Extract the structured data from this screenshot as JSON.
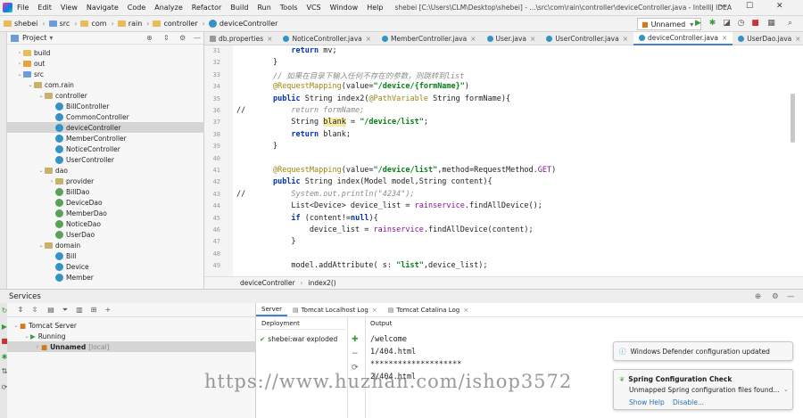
{
  "menubar": {
    "items": [
      "File",
      "Edit",
      "View",
      "Navigate",
      "Code",
      "Analyze",
      "Refactor",
      "Build",
      "Run",
      "Tools",
      "VCS",
      "Window",
      "Help"
    ],
    "window_title": "shebei [C:\\Users\\CLM\\Desktop\\shebei] - ...\\src\\com\\rain\\controller\\deviceController.java - IntelliJ IDEA"
  },
  "breadcrumbs": [
    "shebei",
    "src",
    "com",
    "rain",
    "controller",
    "deviceController"
  ],
  "run_config": "Unnamed",
  "project": {
    "title": "Project",
    "tree": [
      {
        "label": "build",
        "type": "folder",
        "arrow": "›"
      },
      {
        "label": "out",
        "type": "folder-orange",
        "arrow": "›"
      },
      {
        "label": "src",
        "type": "folder-blue",
        "arrow": "⌄"
      },
      {
        "label": "com.rain",
        "type": "package",
        "arrow": "⌄"
      },
      {
        "label": "controller",
        "type": "package",
        "arrow": "⌄"
      },
      {
        "label": "BillController",
        "type": "class",
        "arrow": ""
      },
      {
        "label": "CommonController",
        "type": "class",
        "arrow": ""
      },
      {
        "label": "deviceController",
        "type": "class",
        "arrow": "",
        "selected": true
      },
      {
        "label": "MemberController",
        "type": "class",
        "arrow": ""
      },
      {
        "label": "NoticeController",
        "type": "class",
        "arrow": ""
      },
      {
        "label": "UserController",
        "type": "class",
        "arrow": ""
      },
      {
        "label": "dao",
        "type": "package",
        "arrow": "⌄"
      },
      {
        "label": "provider",
        "type": "package",
        "arrow": "›"
      },
      {
        "label": "BillDao",
        "type": "interface",
        "arrow": ""
      },
      {
        "label": "DeviceDao",
        "type": "interface",
        "arrow": ""
      },
      {
        "label": "MemberDao",
        "type": "interface",
        "arrow": ""
      },
      {
        "label": "NoticeDao",
        "type": "interface",
        "arrow": ""
      },
      {
        "label": "UserDao",
        "type": "interface",
        "arrow": ""
      },
      {
        "label": "domain",
        "type": "package",
        "arrow": "⌄"
      },
      {
        "label": "Bill",
        "type": "class",
        "arrow": ""
      },
      {
        "label": "Device",
        "type": "class",
        "arrow": ""
      },
      {
        "label": "Member",
        "type": "class",
        "arrow": ""
      }
    ]
  },
  "tabs": [
    "db.properties",
    "NoticeController.java",
    "MemberController.java",
    "User.java",
    "UserController.java",
    "deviceController.java",
    "UserDao.java"
  ],
  "active_tab": "deviceController.java",
  "code_lines": [
    {
      "n": "31",
      "html": "            <span class=\"kw\">return</span> mv;"
    },
    {
      "n": "32",
      "html": "        }"
    },
    {
      "n": "33",
      "html": "        <span class=\"cmt\">// 如果在目录下输入任何不存在的参数，则跳转到list</span>"
    },
    {
      "n": "34",
      "html": "        <span class=\"ann\">@RequestMapping</span>(value=<span class=\"str\">\"/device/{formName}\"</span>)"
    },
    {
      "n": "35",
      "html": "        <span class=\"kw\">public</span> String index2(<span class=\"ann\">@PathVariable</span> String formName){"
    },
    {
      "n": "36",
      "html": "//          <span class=\"cmt\">return formName;</span>"
    },
    {
      "n": "37",
      "html": "            String <span class=\"hl\">blank</span> = <span class=\"str\">\"/device/list\"</span>;"
    },
    {
      "n": "38",
      "html": "            <span class=\"kw\">return</span> blank;"
    },
    {
      "n": "39",
      "html": "        }"
    },
    {
      "n": "40",
      "html": ""
    },
    {
      "n": "41",
      "html": "        <span class=\"ann\">@RequestMapping</span>(value=<span class=\"str\">\"/device/list\"</span>,method=RequestMethod.<span class=\"fld\">GET</span>)"
    },
    {
      "n": "42",
      "html": "        <span class=\"kw\">public</span> String index(Model model,String content){"
    },
    {
      "n": "43",
      "html": "//          <span class=\"cmt\">System.out.println(\"4234\");</span>"
    },
    {
      "n": "44",
      "html": "            List&lt;Device&gt; device_list = <span class=\"fld\">rainservice</span>.findAllDevice();"
    },
    {
      "n": "45",
      "html": "            <span class=\"kw\">if</span> (content!=<span class=\"kw\">null</span>){"
    },
    {
      "n": "46",
      "html": "                device_list = <span class=\"fld\">rainservice</span>.findAllDevice(content);"
    },
    {
      "n": "47",
      "html": "            }"
    },
    {
      "n": "48",
      "html": ""
    },
    {
      "n": "49",
      "html": "            model.addAttribute( s: <span class=\"str\">\"list\"</span>,device_list);"
    }
  ],
  "editor_breadcrumbs": [
    "deviceController",
    "index2()"
  ],
  "services": {
    "title": "Services",
    "tree": [
      {
        "label": "Tomcat Server",
        "arrow": "⌄"
      },
      {
        "label": "Running",
        "arrow": "⌄"
      },
      {
        "label": "Unnamed",
        "suffix": "[local]",
        "arrow": "›"
      }
    ],
    "tabs": [
      "Server",
      "Tomcat Localhost Log",
      "Tomcat Catalina Log"
    ],
    "deployment_header": "Deployment",
    "deployment_item": "shebei:war exploded",
    "output_header": "Output",
    "output_lines": [
      "/welcome",
      "1/404.html",
      "********************",
      "2/404.html"
    ]
  },
  "notifications": {
    "defender": "Windows Defender configuration updated",
    "spring_title": "Spring Configuration Check",
    "spring_body": "Unmapped Spring configuration files found...",
    "show_help": "Show Help",
    "disable": "Disable..."
  },
  "watermark": "https://www.huzhan.com/ishop3572",
  "colors": {
    "accent": "#4083c9",
    "keyword": "#0033b3",
    "string": "#067d17",
    "annotation": "#9e880d"
  }
}
